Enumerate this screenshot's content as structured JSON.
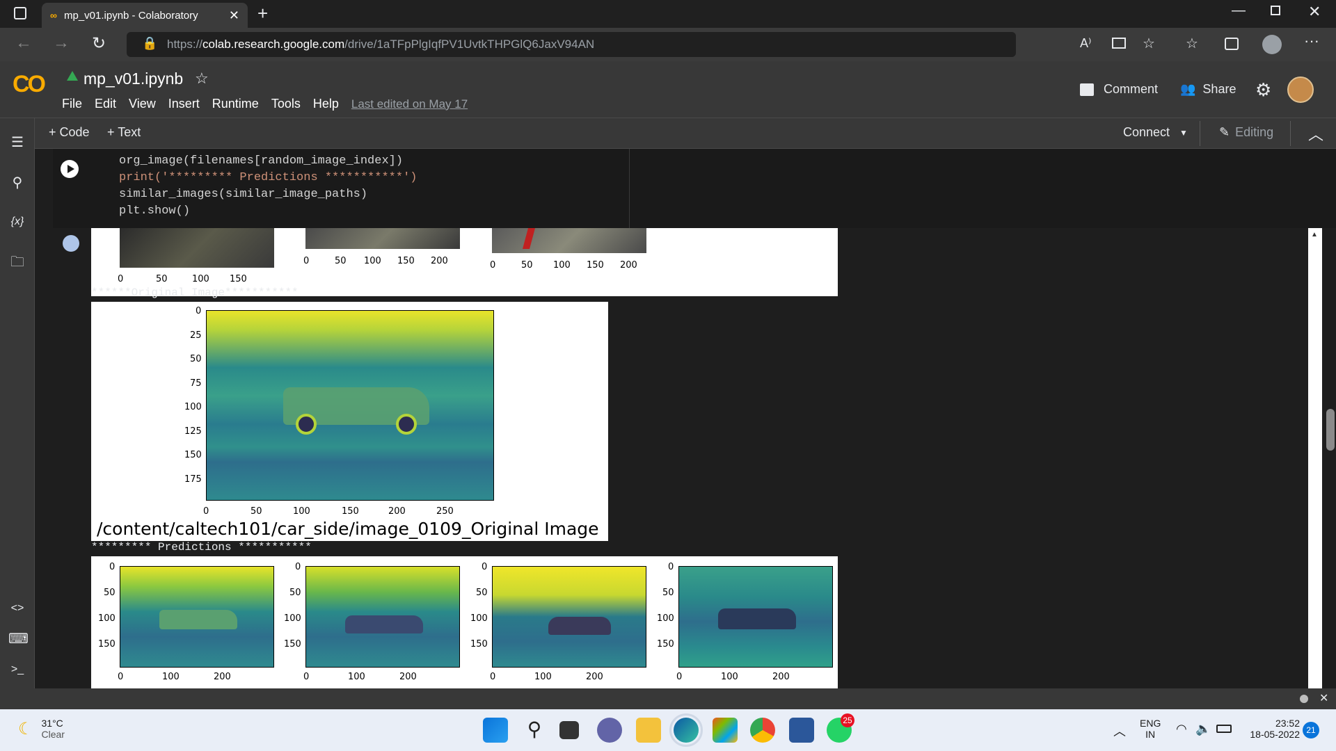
{
  "browser": {
    "tab_title": "mp_v01.ipynb - Colaboratory",
    "url_prefix": "https://",
    "url_host": "colab.research.google.com",
    "url_path": "/drive/1aTFpPlgIqfPV1UvtkTHPGlQ6JaxV94AN"
  },
  "colab": {
    "logo": "CO",
    "notebook_name": "mp_v01.ipynb",
    "menu": [
      "File",
      "Edit",
      "View",
      "Insert",
      "Runtime",
      "Tools",
      "Help"
    ],
    "last_edited": "Last edited on May 17",
    "comment_label": "Comment",
    "share_label": "Share",
    "add_code": "+ Code",
    "add_text": "+ Text",
    "connect_label": "Connect",
    "editing_label": "Editing"
  },
  "code_cell": {
    "lines": [
      "org_image(filenames[random_image_index])",
      "print('********* Predictions ***********')",
      "similar_images(similar_image_paths)",
      "plt.show()"
    ]
  },
  "output": {
    "original_header": "******Original Image***********",
    "predictions_header": "********* Predictions ***********",
    "original_caption": "/content/caltech101/car_side/image_0109_Original Image",
    "top_partial_ticks": [
      [
        "0",
        "50",
        "100",
        "150"
      ],
      [
        "0",
        "50",
        "100",
        "150",
        "200"
      ],
      [
        "0",
        "50",
        "100",
        "150",
        "200"
      ]
    ],
    "original_yticks": [
      "0",
      "25",
      "50",
      "75",
      "100",
      "125",
      "150",
      "175"
    ],
    "original_xticks": [
      "0",
      "50",
      "100",
      "150",
      "200",
      "250"
    ],
    "pred_yticks": [
      "0",
      "50",
      "100",
      "150"
    ],
    "pred_xticks": [
      "0",
      "100",
      "200"
    ]
  },
  "taskbar": {
    "temperature": "31°C",
    "weather": "Clear",
    "lang": "ENG",
    "region": "IN",
    "time": "23:52",
    "date": "18-05-2022",
    "notif_count": "21",
    "whatsapp_badge": "25"
  },
  "colors": {
    "viridis_dark": "#440154",
    "viridis_mid": "#21918c",
    "viridis_light": "#fde725",
    "colab_orange": "#f9ab00"
  }
}
